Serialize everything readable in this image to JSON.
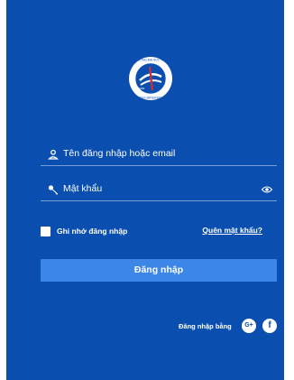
{
  "login": {
    "username_placeholder": "Tên đăng nhập hoặc email",
    "password_placeholder": "Mật khẩu",
    "remember_label": "Ghi nhớ đăng nhập",
    "forgot_link": "Quên mật khẩu?",
    "submit_label": "Đăng nhập",
    "social_label": "Đăng nhập bằng",
    "google_glyph": "G+",
    "facebook_glyph": "f"
  },
  "logo": {
    "ring_text_top": "TRƯỜNG ĐẠI HỌC VINH",
    "ring_text_bottom": "VINH UNIVERSITY",
    "year": "1959"
  },
  "colors": {
    "panel_bg": "#0a4fb0",
    "button_bg": "#3b86e6",
    "text": "#ffffff"
  }
}
